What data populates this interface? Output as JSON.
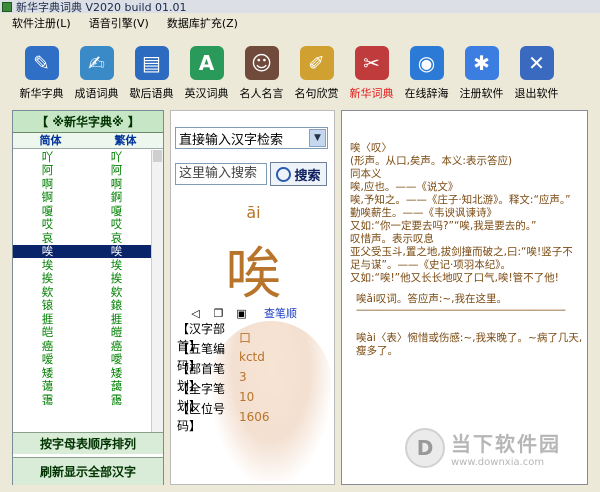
{
  "window": {
    "title": "新华字典词典 V2020 build 01.01"
  },
  "menu": [
    {
      "label": "软件注册(L)"
    },
    {
      "label": "语音引擎(V)"
    },
    {
      "label": "数据库扩充(Z)"
    }
  ],
  "toolbar": [
    {
      "label": "新华字典",
      "icon": "book-pen-icon",
      "color": "#2f6fc6",
      "glyph": "✎"
    },
    {
      "label": "成语词典",
      "icon": "hand-book-icon",
      "color": "#3a8ac8",
      "glyph": "✍"
    },
    {
      "label": "歇后语典",
      "icon": "book-icon",
      "color": "#2d6bc0",
      "glyph": "▤"
    },
    {
      "label": "英汉词典",
      "icon": "globe-book-icon",
      "color": "#2a9a5a",
      "glyph": "A"
    },
    {
      "label": "名人名言",
      "icon": "portrait-icon",
      "color": "#704a3a",
      "glyph": "☺"
    },
    {
      "label": "名句欣赏",
      "icon": "notepad-icon",
      "color": "#d0a030",
      "glyph": "✐"
    },
    {
      "label": "新华词典",
      "icon": "scroll-icon",
      "color": "#c03b3b",
      "glyph": "✂",
      "active": true
    },
    {
      "label": "在线辞海",
      "icon": "globe-icon",
      "color": "#2a7ad6",
      "glyph": "◉"
    },
    {
      "label": "注册软件",
      "icon": "registration-icon",
      "color": "#3b7de0",
      "glyph": "✱"
    },
    {
      "label": "退出软件",
      "icon": "exit-icon",
      "color": "#3a6ac0",
      "glyph": "✕"
    }
  ],
  "left_panel": {
    "title": "【 ※新华字典※ 】",
    "col_simplified": "简体",
    "col_traditional": "繁体",
    "rows": [
      [
        "吖",
        "吖"
      ],
      [
        "阿",
        "阿"
      ],
      [
        "啊",
        "啊"
      ],
      [
        "锕",
        "錒"
      ],
      [
        "嗄",
        "嗄"
      ],
      [
        "哎",
        "哎"
      ],
      [
        "哀",
        "哀"
      ],
      [
        "唉",
        "唉"
      ],
      [
        "埃",
        "埃"
      ],
      [
        "挨",
        "挨"
      ],
      [
        "欸",
        "欸"
      ],
      [
        "锿",
        "鎄"
      ],
      [
        "捱",
        "捱"
      ],
      [
        "皑",
        "皚"
      ],
      [
        "癌",
        "癌"
      ],
      [
        "嗳",
        "噯"
      ],
      [
        "矮",
        "矮"
      ],
      [
        "蔼",
        "藹"
      ],
      [
        "霭",
        "靄"
      ]
    ],
    "selected_index": 7,
    "sort_button": "按字母表顺序排列",
    "refresh_button": "刷新显示全部汉字"
  },
  "middle": {
    "select_value": "直接输入汉字检索",
    "search_placeholder": "这里输入搜索",
    "search_button": "搜索",
    "pinyin": "āi",
    "character": "唉",
    "stroke_link": "查笔顺",
    "info": [
      {
        "key": "【汉字部首】",
        "value": "口"
      },
      {
        "key": "【五笔编码】",
        "value": "kctd"
      },
      {
        "key": "【部首笔划】",
        "value": "3"
      },
      {
        "key": "【全字笔划】",
        "value": "10"
      },
      {
        "key": "【区位号码】",
        "value": "1606"
      }
    ]
  },
  "definition": {
    "block1": "唉〈叹〉\n(形声。从口,矣声。本义:表示答应)\n同本义\n唉,应也。——《说文》\n唉,予知之。——《庄子·知北游》。释文:“应声。”\n勤唉薪生。——《韦谀讽谏诗》\n又如:“你一定要去吗?”“唉,我是要去的。”\n叹惜声。表示叹息\n亚父受玉斗,置之地,拔剑撞而破之,曰:“唉!竖子不足与谋”。——《史记·项羽本纪》。\n又如:“唉!”他又长长地叹了口气,唉!管不了他!",
    "block2": "唉ǎi叹词。答应声:~,我在这里。",
    "dashes": "——————————————————————",
    "block3": "唉ài〈表〉惋惜或伤感:~,我来晚了。~病了几天,瘦多了。"
  },
  "watermark": {
    "line1": "当下软件园",
    "line2": "www.downxia.com"
  }
}
